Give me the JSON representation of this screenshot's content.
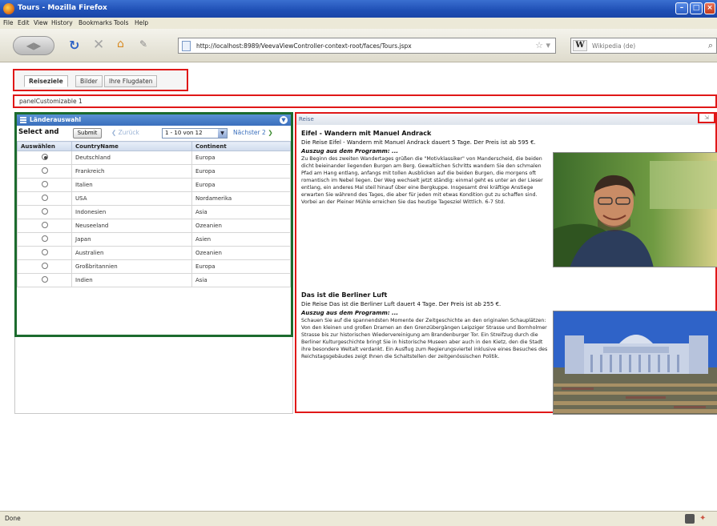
{
  "window": {
    "title": "Tours - Mozilla Firefox"
  },
  "menu": {
    "items": [
      "File",
      "Edit",
      "View",
      "History",
      "Bookmarks",
      "Tools",
      "Help"
    ]
  },
  "nav": {
    "url": "http://localhost:8989/VeevaViewController-context-root/faces/Tours.jspx",
    "search_placeholder": "Wikipedia (de)",
    "search_engine_icon": "W"
  },
  "tabs": [
    "Reiseziele",
    "Bilder",
    "Ihre Flugdaten"
  ],
  "panel_caption": "panelCustomizable 1",
  "country_panel": {
    "title": "Länderauswahl",
    "select_label": "Select and",
    "submit_label": "Submit",
    "prev_label": "Zurück",
    "range": "1 - 10 von 12",
    "next_label": "Nächster 2",
    "columns": [
      "Auswählen",
      "CountryName",
      "Continent"
    ],
    "rows": [
      {
        "country": "Deutschland",
        "continent": "Europa",
        "selected": true
      },
      {
        "country": "Frankreich",
        "continent": "Europa",
        "selected": false
      },
      {
        "country": "Italien",
        "continent": "Europa",
        "selected": false
      },
      {
        "country": "USA",
        "continent": "Nordamerika",
        "selected": false
      },
      {
        "country": "Indonesien",
        "continent": "Asia",
        "selected": false
      },
      {
        "country": "Neuseeland",
        "continent": "Ozeanien",
        "selected": false
      },
      {
        "country": "Japan",
        "continent": "Asien",
        "selected": false
      },
      {
        "country": "Australien",
        "continent": "Ozeanien",
        "selected": false
      },
      {
        "country": "Großbritannien",
        "continent": "Europa",
        "selected": false
      },
      {
        "country": "Indien",
        "continent": "Asia",
        "selected": false
      }
    ]
  },
  "tours_panel": {
    "header": "Reise",
    "tours": [
      {
        "title": "Eifel - Wandern mit Manuel Andrack",
        "summary": "Die Reise Eifel - Wandern mit Manuel Andrack dauert 5 Tage. Der Preis ist ab 595 €.",
        "excerpt_heading": "Auszug aus dem Programm: ...",
        "excerpt": "Zu Beginn des zweiten Wandertages grüßen die \"Motivklassiker\" von Manderscheid, die beiden dicht beieinander liegenden Burgen am Berg. Gewaltiichen Schritts wandern Sie den schmalen Pfad am Hang entlang, anfangs mit tollen Ausblicken auf die beiden Burgen, die morgens oft romantisch im Nebel liegen. Der Weg wechselt jetzt ständig: einmal geht es unter an der Lieser entlang, ein anderes Mal steil hinauf über eine Bergkuppe. Insgesamt drei kräftige Anstiege erwarten Sie während des Tages, die aber für jeden mit etwas Kondition gut zu schaffen sind. Vorbei an der Pleiner Mühle erreichen Sie das heutige Tagesziel Wittlich. 6-7 Std."
      },
      {
        "title": "Das ist die Berliner Luft",
        "summary": "Die Reise Das ist die Berliner Luft dauert 4 Tage. Der Preis ist ab 255 €.",
        "excerpt_heading": "Auszug aus dem Programm: ...",
        "excerpt": "Schauen Sie auf die spannendsten Momente der Zeitgeschichte an den originalen Schauplätzen: Von den kleinen und großen Dramen an den Grenzübergängen Leipziger Strasse und Bornholmer Strasse bis zur historischen Wiedervereinigung am Brandenburger Tor. Ein Streifzug durch die Berliner Kulturgeschichte bringt Sie in historische Museen aber auch in den Kietz, den die Stadt ihre besondere Weltalt verdankt. Ein Ausflug zum Regierungsviertel inklusive eines Besuches des Reichstagsgebäudes zeigt Ihnen die Schaltstellen der zeitgenössischen Politik."
      }
    ]
  },
  "status": {
    "text": "Done"
  }
}
